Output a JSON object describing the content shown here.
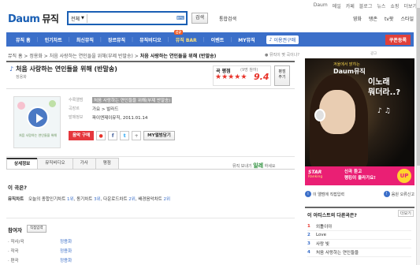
{
  "top_links": [
    "Daum",
    "메일",
    "카페",
    "블로그",
    "뉴스",
    "쇼핑",
    "더보기"
  ],
  "logo": {
    "brand": "Daum",
    "service": "뮤직"
  },
  "search": {
    "scope": "전체",
    "value": "",
    "button": "검색",
    "unified": "통합검색"
  },
  "service_links": [
    "영화",
    "탱존",
    "tv팟",
    "스타일"
  ],
  "nav": {
    "items": [
      "뮤직 홈",
      "인기차트",
      "최신뮤직",
      "장르뮤직",
      "뮤직비디오",
      "뮤직 BAR",
      "이벤트",
      "MY뮤직"
    ],
    "new_badge": "신규",
    "pill": "이용권구매",
    "right": "쿠폰등록"
  },
  "breadcrumb": {
    "parts": [
      "뮤직 홈",
      "정용화",
      "처음 사랑하는 연인들을 위해(부제 반말송)"
    ],
    "current": "처음 사랑하는 연인들을 위해 (반말송)"
  },
  "where_note": "● 뮤직이 몇 곡이나?",
  "song": {
    "title": "처음 사랑하는 연인들을 위해 (반말송)",
    "artist": "정용화"
  },
  "rating": {
    "label": "곡 평점",
    "count": "(9명 참여)",
    "score": "9.4",
    "stars": 4.5,
    "button_line1": "평점",
    "button_line2": "주기"
  },
  "album_art": {
    "caption": "처음 사랑하는 연인들을 위해"
  },
  "info": [
    {
      "k": "수록앨범",
      "v": "처음 사랑하는 연인들을 위해(부제 반말송)",
      "highlight": true
    },
    {
      "k": "곡장르",
      "v": "가요 > 발라드",
      "highlight": false
    },
    {
      "k": "발매정보",
      "v": "파이엔제이뮤직, 2011.01.14",
      "highlight": false
    }
  ],
  "buttons": {
    "buy": "음악 구매",
    "my": "MY앨범담기"
  },
  "share": {
    "text": "뮤직 보내기",
    "brand": "일레",
    "suffix": "하세요"
  },
  "tabs": [
    "상세정보",
    "뮤직비디오",
    "가사",
    "평점"
  ],
  "about_title": "이 곡은?",
  "chart": {
    "label": "뮤직차트",
    "text": "오늘의 종합인기차트",
    "r1": "1위",
    "t2": "동기차트",
    "r2": "3위",
    "t3": "다운로드차트",
    "r3": "2위",
    "t4": "배경음악차트",
    "r4": "2위"
  },
  "credits": {
    "title": "참여자",
    "tab": "직접입력",
    "rows": [
      {
        "k": "· 작사/곡",
        "v": "정용화"
      },
      {
        "k": "· 작곡",
        "v": "정용화"
      },
      {
        "k": "· 편곡",
        "v": "정용화"
      }
    ]
  },
  "ad": {
    "note": "광고",
    "top": "겨울에서 밝히는",
    "logo": "Daum뮤직",
    "headline1": "이노래",
    "headline2": "뭐더라..?",
    "strip_left": "STAR",
    "strip_left2": "Ranking",
    "strip_mid1": "신곡 듣고",
    "strip_mid2": "랭킹이 올라가요!",
    "strip_up": "UP"
  },
  "side_buttons": {
    "a": "이 앨범에 직접입력",
    "b": "음원 오류신고"
  },
  "other_songs": {
    "title": "이 아티스트의 다른곡은?",
    "more": "더보기",
    "items": [
      {
        "n": "1",
        "t": "외톨이야"
      },
      {
        "n": "2",
        "t": "Love"
      },
      {
        "n": "3",
        "t": "사랑 빛"
      },
      {
        "n": "4",
        "t": "처음 사랑하는 연인들을"
      }
    ]
  },
  "colors": {
    "brand_blue": "#3b6fc9",
    "accent_red": "#e8332a"
  }
}
